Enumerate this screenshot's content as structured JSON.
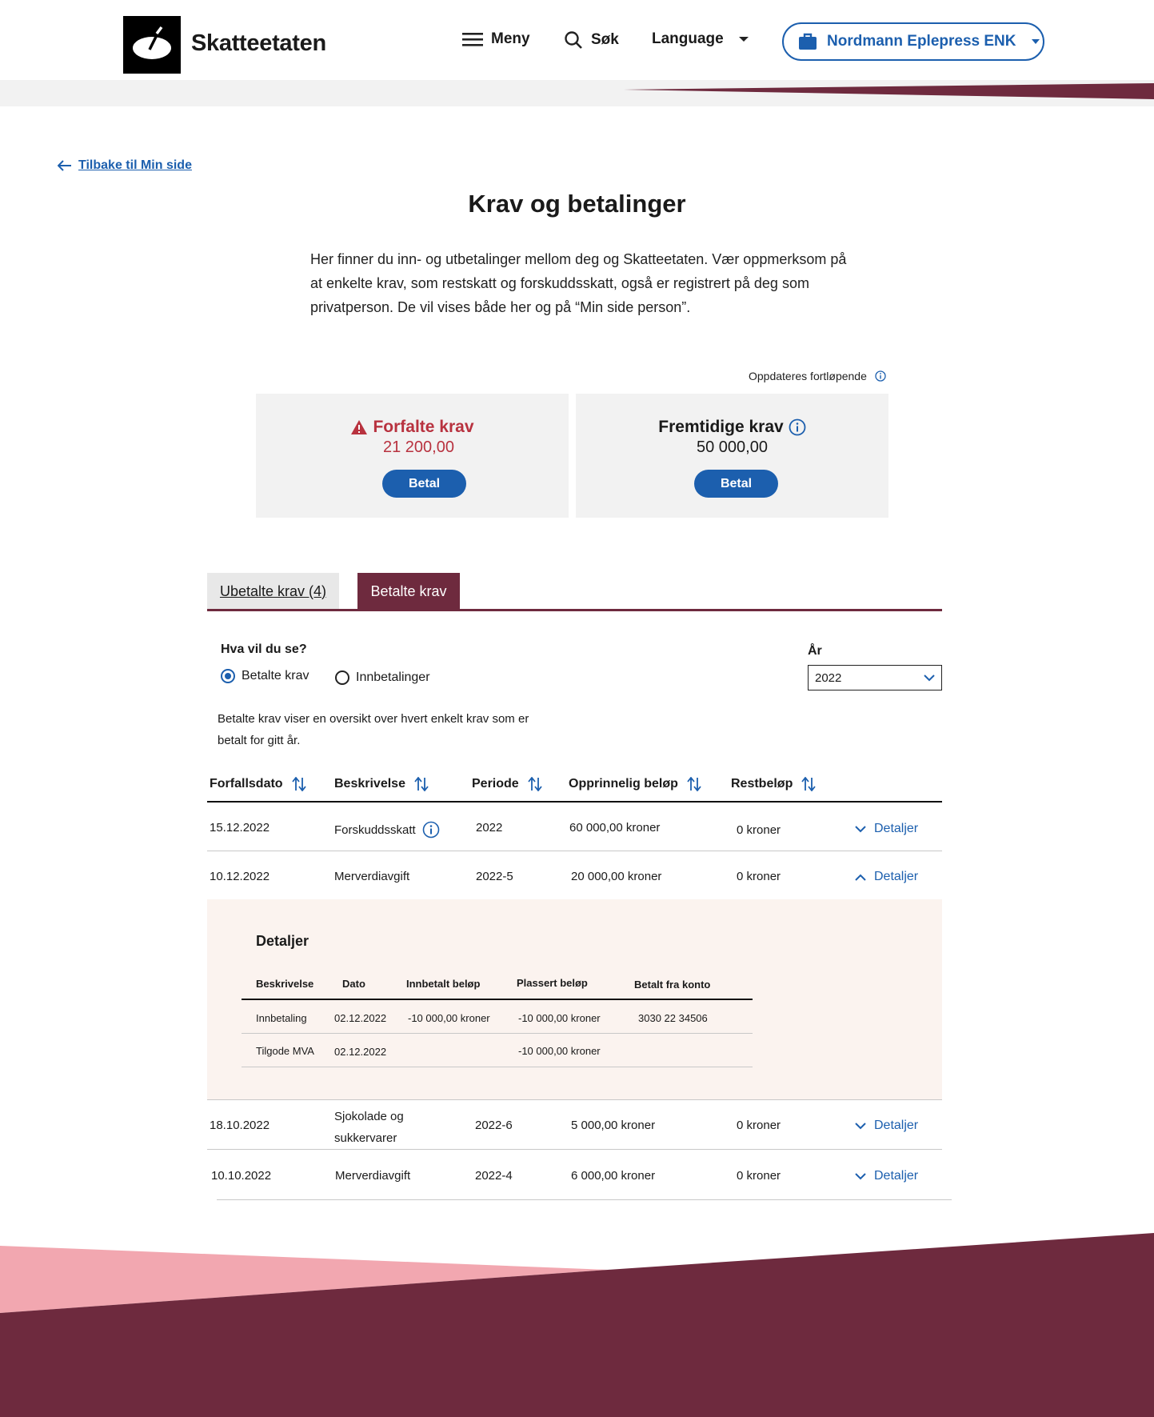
{
  "header": {
    "brand": "Skatteetaten",
    "menu_label": "Meny",
    "search_label": "Søk",
    "language_label": "Language",
    "org_label": "Nordmann Eplepress ENK"
  },
  "back_link": "Tilbake til Min side",
  "page_title": "Krav og betalinger",
  "intro": "Her finner du inn- og utbetalinger mellom deg og Skatteetaten. Vær oppmerksom på at enkelte krav, som restskatt og forskuddsskatt, også er registrert på deg som privatperson. De vil vises både her og på “Min side person”.",
  "updated_label": "Oppdateres fortløpende",
  "cards": {
    "overdue": {
      "title": "Forfalte krav",
      "amount": "21 200,00",
      "button": "Betal"
    },
    "future": {
      "title": "Fremtidige krav",
      "amount": "50 000,00",
      "button": "Betal"
    }
  },
  "tabs": {
    "unpaid": "Ubetalte krav (4)",
    "paid": "Betalte krav"
  },
  "filter": {
    "question": "Hva vil du se?",
    "option_paid": "Betalte krav",
    "option_payments": "Innbetalinger",
    "year_label": "År",
    "year_value": "2022",
    "description": "Betalte krav viser en oversikt over hvert enkelt krav som er betalt for gitt år."
  },
  "table": {
    "headers": [
      "Forfallsdato",
      "Beskrivelse",
      "Periode",
      "Opprinnelig beløp",
      "Restbeløp"
    ],
    "details_label": "Detaljer",
    "rows": [
      {
        "date": "15.12.2022",
        "desc": "Forskuddsskatt",
        "period": "2022",
        "original": "60 000,00 kroner",
        "rest": "0 kroner"
      },
      {
        "date": "10.12.2022",
        "desc": "Merverdiavgift",
        "period": "2022-5",
        "original": "20 000,00 kroner",
        "rest": "0 kroner"
      },
      {
        "date": "18.10.2022",
        "desc": "Sjokolade og sukkervarer",
        "period": "2022-6",
        "original": "5 000,00 kroner",
        "rest": "0 kroner"
      },
      {
        "date": "10.10.2022",
        "desc": "Merverdiavgift",
        "period": "2022-4",
        "original": "6 000,00 kroner",
        "rest": "0 kroner"
      }
    ]
  },
  "details": {
    "title": "Detaljer",
    "headers": [
      "Beskrivelse",
      "Dato",
      "Innbetalt beløp",
      "Plassert beløp",
      "Betalt fra konto"
    ],
    "rows": [
      {
        "desc": "Innbetaling",
        "date": "02.12.2022",
        "paid": "-10 000,00 kroner",
        "placed": "-10 000,00 kroner",
        "account": "3030 22 34506"
      },
      {
        "desc": "Tilgode MVA",
        "date": "02.12.2022",
        "paid": "",
        "placed": "-10 000,00 kroner",
        "account": ""
      }
    ]
  },
  "colors": {
    "primary_blue": "#1c5fae",
    "burgundy": "#6e2a3e",
    "error_red": "#b8323f",
    "pink": "#f2a7b0",
    "card_bg": "#f2f2f2",
    "details_bg": "#fbf3ef"
  }
}
